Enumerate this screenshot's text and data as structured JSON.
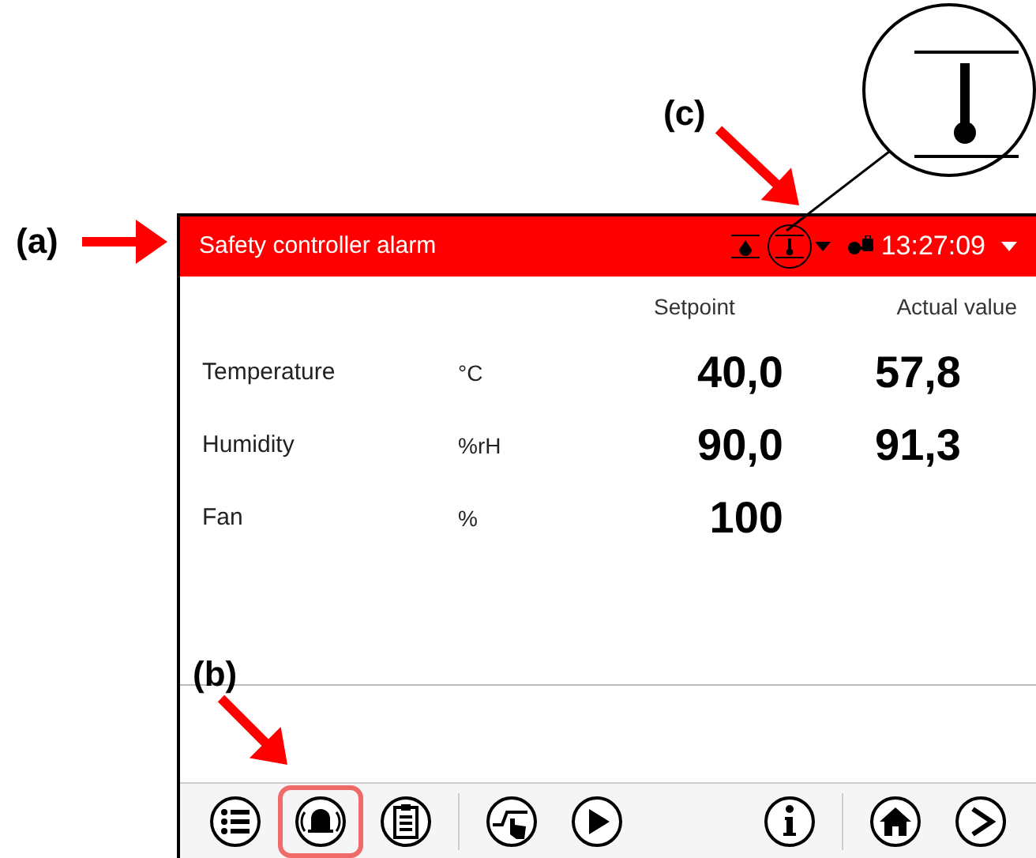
{
  "annotations": [
    {
      "label": "(a)"
    },
    {
      "label": "(b)"
    },
    {
      "label": "(c)"
    }
  ],
  "header": {
    "title": "Safety controller alarm",
    "time": "13:27:09",
    "alarm": true
  },
  "table": {
    "columns": [
      "Setpoint",
      "Actual value"
    ],
    "rows": [
      {
        "name": "Temperature",
        "unit": "°C",
        "setpoint": "40,0",
        "actual": "57,8"
      },
      {
        "name": "Humidity",
        "unit": "%rH",
        "setpoint": "90,0",
        "actual": "91,3"
      },
      {
        "name": "Fan",
        "unit": "%",
        "setpoint": "100"
      }
    ]
  },
  "toolbar": [
    [
      {
        "kind": "list",
        "highlighted": false
      },
      {
        "kind": "alarm",
        "highlighted": true
      },
      {
        "kind": "clipboard",
        "highlighted": false
      }
    ],
    [
      {
        "kind": "manual",
        "highlighted": false
      },
      {
        "kind": "play",
        "highlighted": false
      }
    ],
    [
      {
        "kind": "info",
        "highlighted": false
      }
    ],
    [
      {
        "kind": "home",
        "highlighted": false
      },
      {
        "kind": "next",
        "highlighted": false
      }
    ]
  ]
}
